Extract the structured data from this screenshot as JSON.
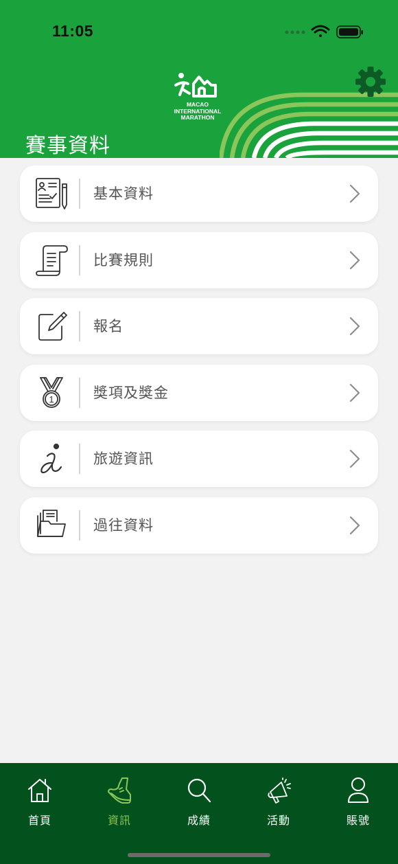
{
  "status_bar": {
    "time": "11:05"
  },
  "header": {
    "title": "賽事資料",
    "logo_lines": [
      "MACAO",
      "INTERNATIONAL",
      "MARATHON"
    ]
  },
  "menu": [
    {
      "label": "基本資料",
      "icon": "document-person-icon"
    },
    {
      "label": "比賽規則",
      "icon": "scroll-icon"
    },
    {
      "label": "報名",
      "icon": "edit-icon"
    },
    {
      "label": "獎項及獎金",
      "icon": "medal-icon"
    },
    {
      "label": "旅遊資訊",
      "icon": "info-icon"
    },
    {
      "label": "過往資料",
      "icon": "folder-icon"
    }
  ],
  "tabs": [
    {
      "label": "首頁",
      "icon": "home-icon",
      "active": false
    },
    {
      "label": "資訊",
      "icon": "shoe-icon",
      "active": true
    },
    {
      "label": "成績",
      "icon": "search-icon",
      "active": false
    },
    {
      "label": "活動",
      "icon": "megaphone-icon",
      "active": false
    },
    {
      "label": "賬號",
      "icon": "user-icon",
      "active": false
    }
  ],
  "colors": {
    "header_green": "#1aa33c",
    "tabbar_green": "#03521d",
    "active_tab": "#8bc65a",
    "gear": "#0d5a26"
  }
}
